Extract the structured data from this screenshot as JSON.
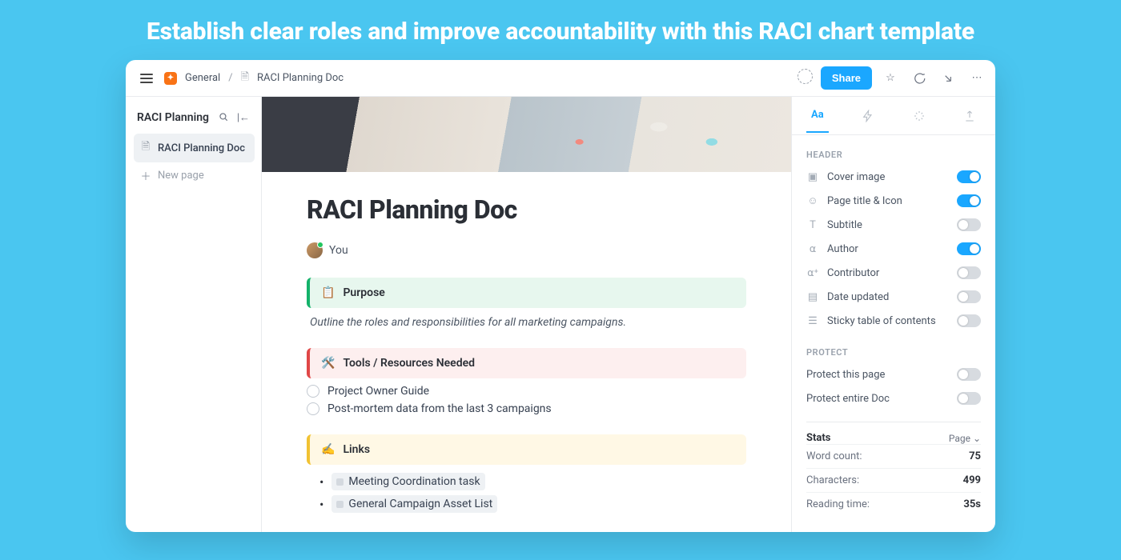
{
  "hero": {
    "title": "Establish clear roles and improve accountability with this RACI chart template"
  },
  "breadcrumb": {
    "space": "General",
    "doc": "RACI Planning Doc"
  },
  "topbar": {
    "share_label": "Share"
  },
  "sidebar": {
    "title": "RACI Planning",
    "items": [
      "RACI Planning Doc"
    ],
    "new_label": "New page"
  },
  "doc": {
    "title": "RACI Planning Doc",
    "author": "You",
    "purpose": {
      "emoji": "📋",
      "label": "Purpose",
      "desc": "Outline the roles and responsibilities for all marketing campaigns."
    },
    "tools": {
      "emoji": "🛠️",
      "label": "Tools / Resources Needed",
      "items": [
        "Project Owner Guide",
        "Post-mortem data from the last 3 campaigns"
      ]
    },
    "links": {
      "emoji": "✍️",
      "label": "Links",
      "items": [
        "Meeting Coordination task",
        "General Campaign Asset List"
      ]
    }
  },
  "panel": {
    "tabs_active": "Aa",
    "header_section": "HEADER",
    "header_toggles": [
      {
        "label": "Cover image",
        "on": true
      },
      {
        "label": "Page title & Icon",
        "on": true
      },
      {
        "label": "Subtitle",
        "on": false
      },
      {
        "label": "Author",
        "on": true
      },
      {
        "label": "Contributor",
        "on": false
      },
      {
        "label": "Date updated",
        "on": false
      },
      {
        "label": "Sticky table of contents",
        "on": false
      }
    ],
    "protect_section": "PROTECT",
    "protect_toggles": [
      {
        "label": "Protect this page",
        "on": false
      },
      {
        "label": "Protect entire Doc",
        "on": false
      }
    ],
    "stats": {
      "title": "Stats",
      "scope": "Page",
      "rows": [
        {
          "label": "Word count:",
          "value": "75"
        },
        {
          "label": "Characters:",
          "value": "499"
        },
        {
          "label": "Reading time:",
          "value": "35s"
        }
      ]
    }
  }
}
